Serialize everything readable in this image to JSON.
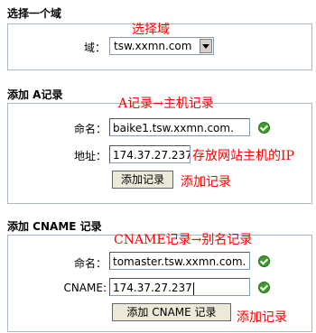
{
  "section_domain": {
    "heading": "选择一个域",
    "domain_label": "域：",
    "domain_value": "tsw.xxmn.com",
    "annotation": "选择域"
  },
  "section_a": {
    "heading": "添加 A记录",
    "annotation_title": "A记录→主机记录",
    "name_label": "命名：",
    "name_value": "baike1.tsw.xxmn.com.",
    "address_label": "地址：",
    "address_value": "174.37.27.237",
    "address_annotation": "存放网站主机的IP",
    "add_button": "添加记录",
    "button_annotation": "添加记录"
  },
  "section_cname": {
    "heading": "添加 CNAME 记录",
    "annotation_title": "CNAME记录→别名记录",
    "name_label": "命名：",
    "name_value": "tomaster.tsw.xxmn.com.",
    "cname_label": "CNAME:",
    "cname_value": "174.37.27.237",
    "add_button": "添加 CNAME 记录",
    "button_annotation": "添加记录"
  },
  "colors": {
    "annotation": "#ff0000",
    "panel_border": "#aab7c7",
    "check": "#3f9c2c"
  },
  "icons": [
    "dropdown-arrow-icon",
    "check-icon"
  ]
}
